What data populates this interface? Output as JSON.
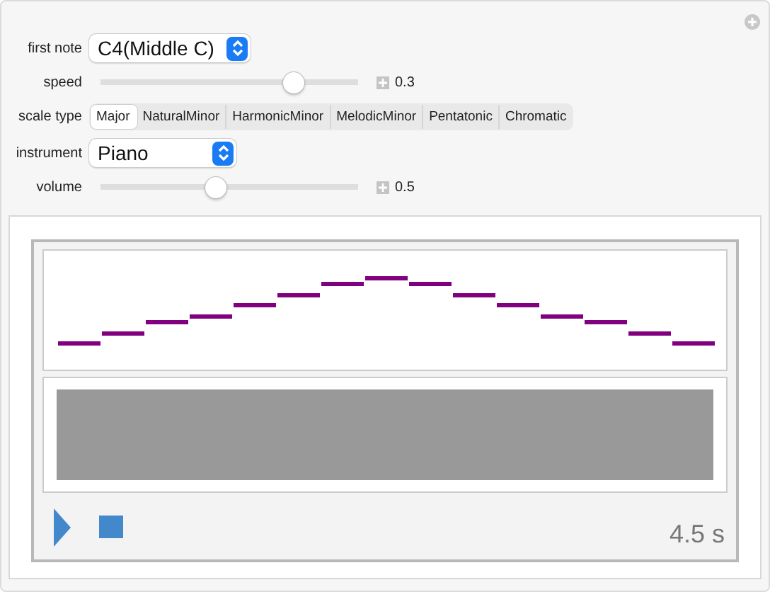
{
  "controls": [
    {
      "kind": "dropdown",
      "label": "first note",
      "value": "C4(Middle C)"
    },
    {
      "kind": "slider",
      "label": "speed",
      "level": 0.75,
      "reading": "0.3"
    },
    {
      "kind": "segmented",
      "label": "scale type",
      "options": [
        {
          "label": "Major",
          "selected": true
        },
        {
          "label": "NaturalMinor",
          "selected": false
        },
        {
          "label": "HarmonicMinor",
          "selected": false
        },
        {
          "label": "MelodicMinor",
          "selected": false
        },
        {
          "label": "Pentatonic",
          "selected": false
        },
        {
          "label": "Chromatic",
          "selected": false
        }
      ]
    },
    {
      "kind": "dropdown",
      "label": "instrument",
      "value": "Piano"
    },
    {
      "kind": "slider",
      "label": "volume",
      "level": 0.45,
      "reading": "0.5"
    }
  ],
  "player": {
    "duration": "4.5 s"
  }
}
